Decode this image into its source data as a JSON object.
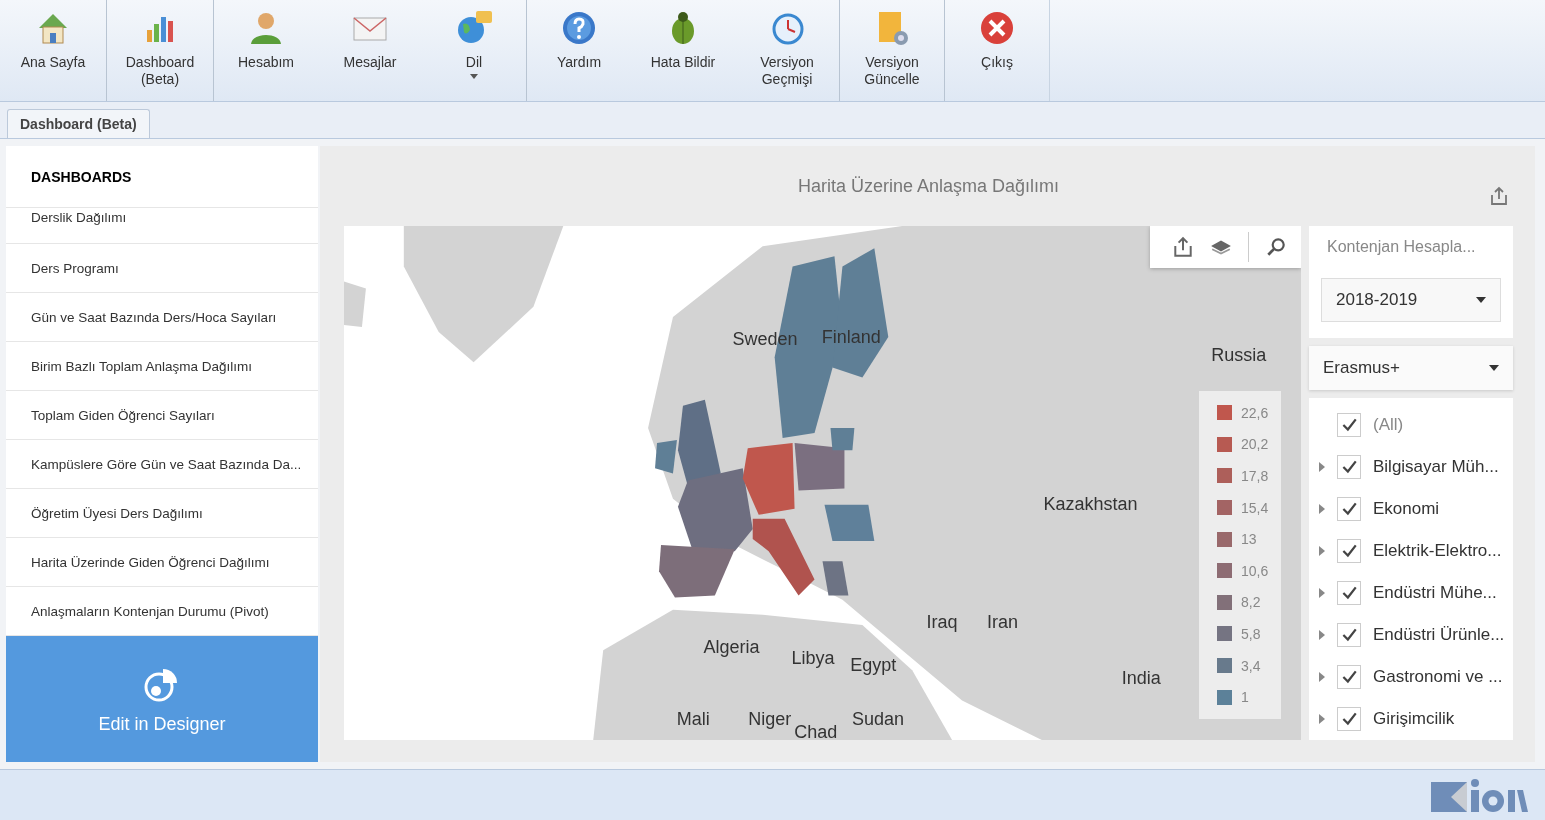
{
  "toolbar": {
    "groups": [
      [
        {
          "label": "Ana Sayfa"
        }
      ],
      [
        {
          "label": "Dashboard (Beta)"
        }
      ],
      [
        {
          "label": "Hesabım"
        },
        {
          "label": "Mesajlar"
        },
        {
          "label": "Dil",
          "dropdown": true
        }
      ],
      [
        {
          "label": "Yardım"
        },
        {
          "label": "Hata Bildir"
        },
        {
          "label": "Versiyon Geçmişi"
        }
      ],
      [
        {
          "label": "Versiyon Güncelle"
        }
      ],
      [
        {
          "label": "Çıkış"
        }
      ]
    ]
  },
  "tabs": [
    {
      "label": "Dashboard (Beta)",
      "selected": true
    }
  ],
  "sidebar": {
    "title": "DASHBOARDS",
    "items": [
      {
        "label": "Derslik Dağılımı",
        "selected": false
      },
      {
        "label": "Ders Programı",
        "selected": false
      },
      {
        "label": "Gün ve Saat Bazında Ders/Hoca Sayıları",
        "selected": false
      },
      {
        "label": "Birim Bazlı Toplam Anlaşma Dağılımı",
        "selected": false
      },
      {
        "label": "Toplam Giden Öğrenci Sayıları",
        "selected": false
      },
      {
        "label": "Kampüslere Göre Gün ve Saat Bazında Da...",
        "selected": false
      },
      {
        "label": "Öğretim Üyesi Ders Dağılımı",
        "selected": false
      },
      {
        "label": "Harita Üzerinde Giden Öğrenci Dağılımı",
        "selected": false
      },
      {
        "label": "Anlaşmaların Kontenjan Durumu (Pivot)",
        "selected": false
      }
    ],
    "designer_button": "Edit in Designer"
  },
  "map_panel": {
    "title": "Harita Üzerine Anlaşma Dağılımı",
    "labels": [
      {
        "text": "Sweden"
      },
      {
        "text": "Finland"
      },
      {
        "text": "Russia"
      },
      {
        "text": "Kazakhstan"
      },
      {
        "text": "Iraq"
      },
      {
        "text": "Iran"
      },
      {
        "text": "Algeria"
      },
      {
        "text": "Libya"
      },
      {
        "text": "Egypt"
      },
      {
        "text": "India"
      },
      {
        "text": "Mali"
      },
      {
        "text": "Niger"
      },
      {
        "text": "Chad"
      },
      {
        "text": "Sudan"
      }
    ],
    "legend": [
      {
        "label": "22,6",
        "color": "#c0574d"
      },
      {
        "label": "20,2",
        "color": "#b75a52"
      },
      {
        "label": "17,8",
        "color": "#ad5f5a"
      },
      {
        "label": "15,4",
        "color": "#a36464"
      },
      {
        "label": "13",
        "color": "#99696b"
      },
      {
        "label": "10,6",
        "color": "#8d6c73"
      },
      {
        "label": "8,2",
        "color": "#827079"
      },
      {
        "label": "5,8",
        "color": "#757482"
      },
      {
        "label": "3,4",
        "color": "#687a8c"
      },
      {
        "label": "1",
        "color": "#5c8199"
      }
    ]
  },
  "filters": {
    "title": "Kontenjan Hesapla...",
    "year": "2018-2019",
    "program": "Erasmus+",
    "items": [
      {
        "kind": "all",
        "label": "(All)",
        "checked": true
      },
      {
        "kind": "group",
        "label": "Bilgisayar Müh...",
        "checked": true,
        "expanded": false
      },
      {
        "kind": "group",
        "label": "Ekonomi",
        "checked": true,
        "expanded": false
      },
      {
        "kind": "group",
        "label": "Elektrik-Elektro...",
        "checked": true,
        "expanded": false
      },
      {
        "kind": "group",
        "label": "Endüstri Mühe...",
        "checked": true,
        "expanded": false
      },
      {
        "kind": "group",
        "label": "Endüstri Ürünle...",
        "checked": true,
        "expanded": false
      },
      {
        "kind": "group",
        "label": "Gastronomi ve ...",
        "checked": true,
        "expanded": false
      },
      {
        "kind": "group",
        "label": "Girişimcilik",
        "checked": true,
        "expanded": false
      }
    ]
  }
}
